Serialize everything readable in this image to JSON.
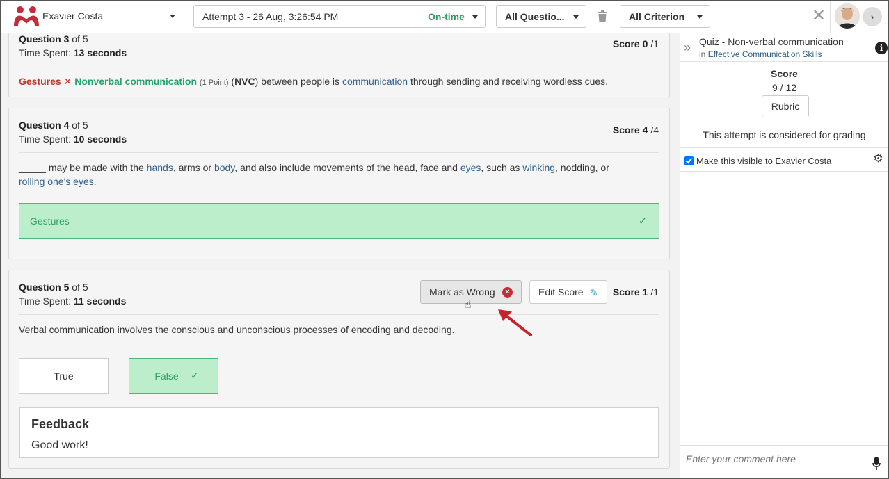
{
  "header": {
    "student_name": "Exavier Costa",
    "attempt_label": "Attempt 3 - 26 Aug, 3:26:54 PM",
    "attempt_status": "On-time",
    "questions_filter": "All Questio...",
    "criterion_filter": "All Criterion",
    "close_symbol": "✕",
    "next_symbol": "›"
  },
  "questions": [
    {
      "number": "3",
      "of": "of 5",
      "label": "Question",
      "time_label": "Time Spent:",
      "time_value": "13 seconds",
      "score_label": "Score",
      "score_value": "0",
      "score_total": "/1",
      "wrong_answer": "Gestures",
      "correct_answer": "Nonverbal communication",
      "points": "(1 Point)",
      "text_open": "(",
      "abbrev": "NVC",
      "text_mid": ") between people is ",
      "kw1": "communication",
      "text_end": " through sending and receiving wordless cues."
    },
    {
      "number": "4",
      "of": "of 5",
      "label": "Question",
      "time_label": "Time Spent:",
      "time_value": "10 seconds",
      "score_label": "Score",
      "score_value": "4",
      "score_total": "/4",
      "t1": "_____ may be made with the ",
      "kw_hands": "hands",
      "t2": ", arms or ",
      "kw_body": "body",
      "t3": ", and also include movements of the head, face and ",
      "kw_eyes": "eyes",
      "t4": ", such as ",
      "kw_winking": "winking",
      "t5": ", nodding, or",
      "kw_rolling": "rolling one's eyes",
      "t6": ".",
      "answer": "Gestures"
    },
    {
      "number": "5",
      "of": "of 5",
      "label": "Question",
      "time_label": "Time Spent:",
      "time_value": "11 seconds",
      "score_label": "Score",
      "score_value": "1",
      "score_total": "/1",
      "mark_wrong": "Mark as Wrong",
      "edit_score": "Edit Score",
      "text": "Verbal communication involves the conscious and unconscious processes of encoding and decoding.",
      "option_true": "True",
      "option_false": "False",
      "feedback_title": "Feedback",
      "feedback_body": "Good work!"
    }
  ],
  "panel": {
    "quiz_title": "Quiz - Non-verbal communication",
    "in_label": "in",
    "course": "Effective Communication Skills",
    "score_label": "Score",
    "score_value": "9 / 12",
    "rubric": "Rubric",
    "grading_note": "This attempt is considered for grading",
    "visible_label": "Make this visible to Exavier Costa",
    "comment_placeholder": "Enter your comment here"
  },
  "colors": {
    "correct": "#27a06b",
    "wrong": "#c0392b",
    "link": "#2f5e8a",
    "annotation_arrow": "#c8232c"
  }
}
